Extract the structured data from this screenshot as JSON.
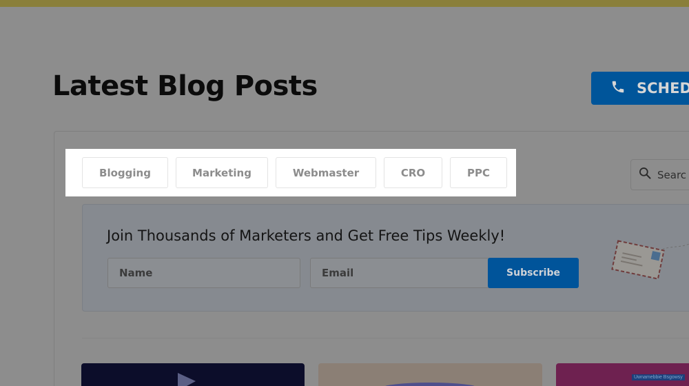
{
  "header": {
    "title": "Latest Blog Posts",
    "schedule_label": "SCHED",
    "icon": "phone-icon"
  },
  "categories": [
    {
      "label": "Blogging"
    },
    {
      "label": "Marketing"
    },
    {
      "label": "Webmaster"
    },
    {
      "label": "CRO"
    },
    {
      "label": "PPC"
    }
  ],
  "search": {
    "placeholder": "Searc",
    "icon": "search-icon"
  },
  "newsletter": {
    "heading": "Join Thousands of Marketers and Get Free Tips Weekly!",
    "name_placeholder": "Name",
    "email_placeholder": "Email",
    "subscribe_label": "Subscribe",
    "illustration": "airmail-envelope-icon"
  },
  "posts": [
    {
      "thumb": "dark-video-thumbnail"
    },
    {
      "thumb": "beige-thumbnail"
    },
    {
      "thumb": "magenta-thumbnail",
      "caption": "Uwnamebbie Bsgowsy"
    }
  ],
  "colors": {
    "accent_blue": "#0073c5",
    "top_bar": "#d4c24f",
    "highlight_bg": "#ffffff"
  }
}
